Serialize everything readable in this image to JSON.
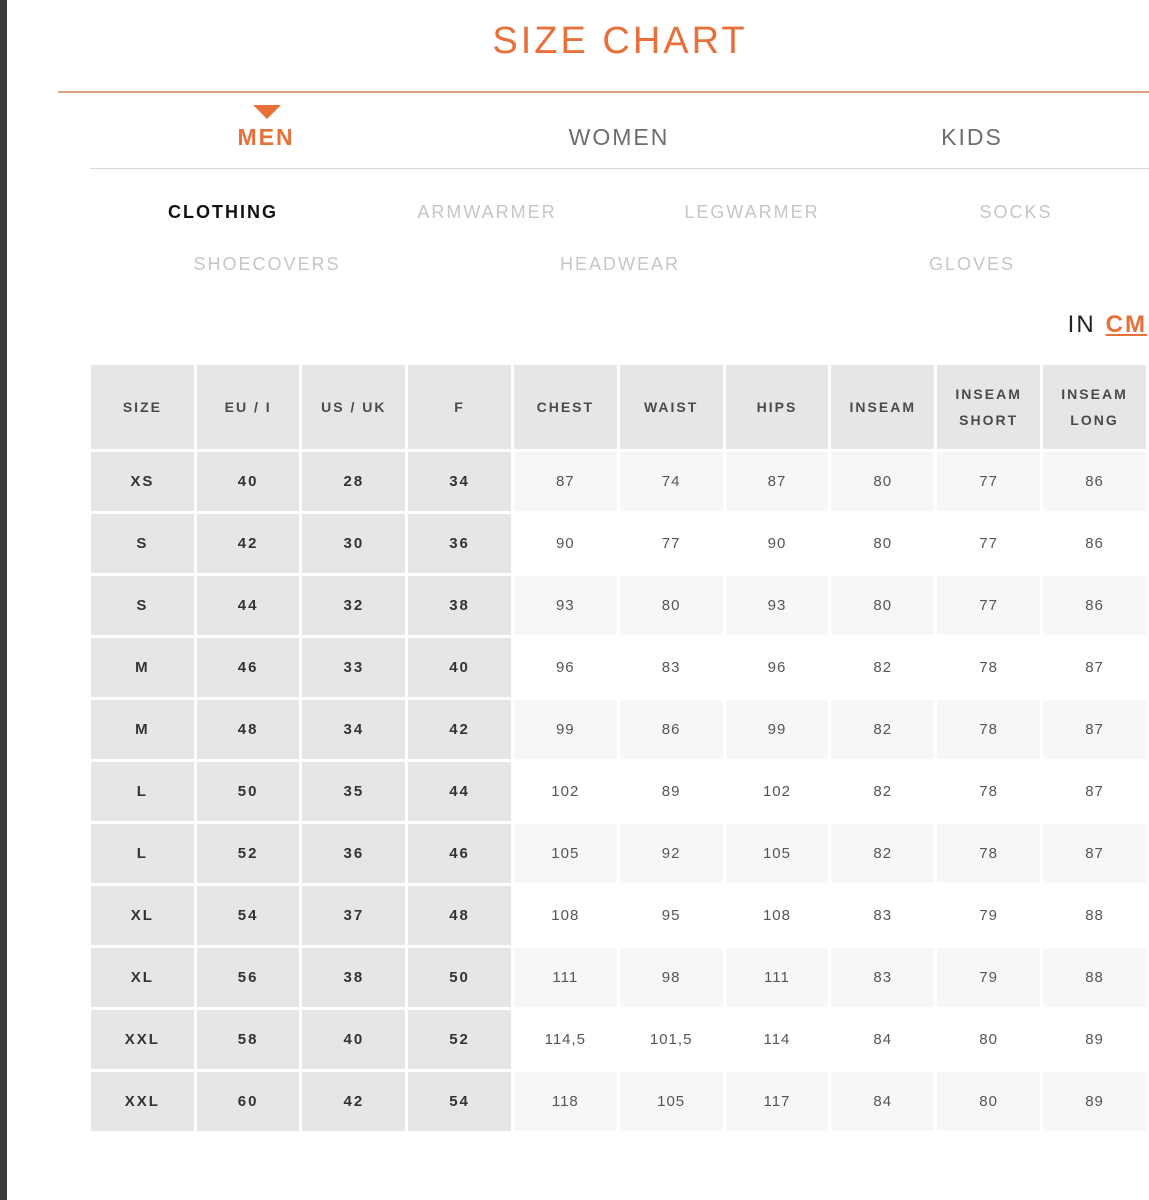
{
  "title": "SIZE CHART",
  "gender_tabs": [
    {
      "label": "MEN",
      "active": true
    },
    {
      "label": "WOMEN",
      "active": false
    },
    {
      "label": "KIDS",
      "active": false
    }
  ],
  "categories": [
    {
      "label": "CLOTHING",
      "active": true
    },
    {
      "label": "ARMWARMER",
      "active": false
    },
    {
      "label": "LEGWARMER",
      "active": false
    },
    {
      "label": "SOCKS",
      "active": false
    },
    {
      "label": "SHOECOVERS",
      "active": false
    },
    {
      "label": "HEADWEAR",
      "active": false
    },
    {
      "label": "GLOVES",
      "active": false
    }
  ],
  "units": {
    "in_label": "IN",
    "cm_label": "CM",
    "selected": "CM"
  },
  "colors": {
    "accent": "#e8703a",
    "header_bg": "#e6e6e6",
    "rule": "#d9a486"
  },
  "icons": {
    "active_tab_marker": "triangle-down-icon"
  },
  "table": {
    "headers": [
      "SIZE",
      "EU / I",
      "US / UK",
      "F",
      "CHEST",
      "WAIST",
      "HIPS",
      "INSEAM",
      [
        "INSEAM",
        "SHORT"
      ],
      [
        "INSEAM",
        "LONG"
      ]
    ],
    "rows": [
      [
        "XS",
        "40",
        "28",
        "34",
        "87",
        "74",
        "87",
        "80",
        "77",
        "86"
      ],
      [
        "S",
        "42",
        "30",
        "36",
        "90",
        "77",
        "90",
        "80",
        "77",
        "86"
      ],
      [
        "S",
        "44",
        "32",
        "38",
        "93",
        "80",
        "93",
        "80",
        "77",
        "86"
      ],
      [
        "M",
        "46",
        "33",
        "40",
        "96",
        "83",
        "96",
        "82",
        "78",
        "87"
      ],
      [
        "M",
        "48",
        "34",
        "42",
        "99",
        "86",
        "99",
        "82",
        "78",
        "87"
      ],
      [
        "L",
        "50",
        "35",
        "44",
        "102",
        "89",
        "102",
        "82",
        "78",
        "87"
      ],
      [
        "L",
        "52",
        "36",
        "46",
        "105",
        "92",
        "105",
        "82",
        "78",
        "87"
      ],
      [
        "XL",
        "54",
        "37",
        "48",
        "108",
        "95",
        "108",
        "83",
        "79",
        "88"
      ],
      [
        "XL",
        "56",
        "38",
        "50",
        "111",
        "98",
        "111",
        "83",
        "79",
        "88"
      ],
      [
        "XXL",
        "58",
        "40",
        "52",
        "114,5",
        "101,5",
        "114",
        "84",
        "80",
        "89"
      ],
      [
        "XXL",
        "60",
        "42",
        "54",
        "118",
        "105",
        "117",
        "84",
        "80",
        "89"
      ]
    ]
  }
}
